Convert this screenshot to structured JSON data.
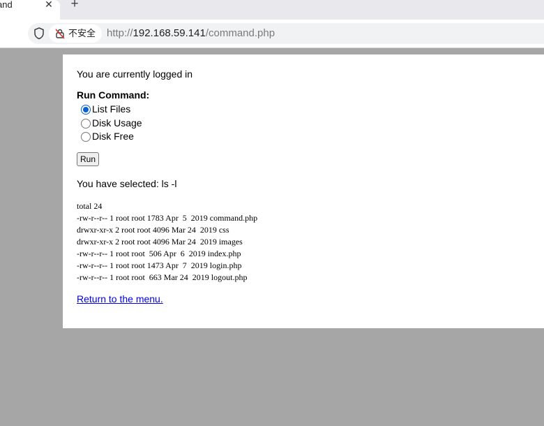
{
  "browser": {
    "tab_title": "and",
    "tab_close": "✕",
    "new_tab": "+",
    "security_label": "不安全",
    "url_scheme": "http://",
    "url_host": "192.168.59.141",
    "url_path": "/command.php"
  },
  "page": {
    "status_text": "You are currently logged in",
    "run_command_label": "Run Command:",
    "options": [
      {
        "label": "List Files",
        "checked": true
      },
      {
        "label": "Disk Usage",
        "checked": false
      },
      {
        "label": "Disk Free",
        "checked": false
      }
    ],
    "run_button": "Run",
    "selected_text": "You have selected: ls -l",
    "output_lines": [
      "total 24",
      "-rw-r--r-- 1 root root 1783 Apr  5  2019 command.php",
      "drwxr-xr-x 2 root root 4096 Mar 24  2019 css",
      "drwxr-xr-x 2 root root 4096 Mar 24  2019 images",
      "-rw-r--r-- 1 root root  506 Apr  6  2019 index.php",
      "-rw-r--r-- 1 root root 1473 Apr  7  2019 login.php",
      "-rw-r--r-- 1 root root  663 Mar 24  2019 logout.php"
    ],
    "return_link": "Return to the menu."
  },
  "colors": {
    "page_background": "#a6a6a6",
    "link": "#0000ee",
    "radio_checked": "#0a5fd1"
  },
  "icons": {
    "site_info": "shield-icon",
    "security": "not-secure-lock-icon"
  }
}
